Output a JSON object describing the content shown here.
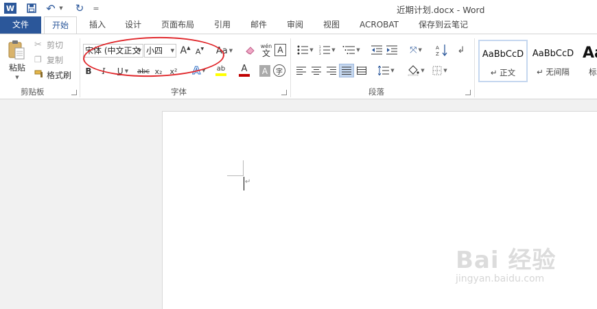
{
  "titlebar": {
    "title": "近期计划.docx - Word",
    "word_icon": "W",
    "save_icon": "floppy-icon",
    "undo_icon": "↶",
    "redo_icon": "↻",
    "customize_icon": "="
  },
  "tabs": {
    "file": "文件",
    "home": "开始",
    "insert": "插入",
    "design": "设计",
    "layout": "页面布局",
    "references": "引用",
    "mailings": "邮件",
    "review": "审阅",
    "view": "视图",
    "acrobat": "ACROBAT",
    "youdao": "保存到云笔记"
  },
  "clipboard": {
    "paste": "粘贴",
    "cut": "剪切",
    "copy": "复制",
    "format_painter": "格式刷",
    "group_label": "剪贴板"
  },
  "font": {
    "font_name": "宋体 (中文正文",
    "font_size": "小四",
    "grow": "A",
    "shrink": "A",
    "change_case": "Aa",
    "clear_format": "",
    "phonetic": "wén",
    "phonetic_char": "文",
    "border_char": "A",
    "bold": "B",
    "italic": "I",
    "underline": "U",
    "strike": "abc",
    "subscript": "x₂",
    "superscript": "x²",
    "text_effect": "A",
    "highlight": "ab",
    "font_color": "A",
    "char_shading": "A",
    "enclose_char": "字",
    "group_label": "字体"
  },
  "paragraph": {
    "group_label": "段落"
  },
  "styles": {
    "normal_sample": "AaBbCcD",
    "normal_name": "正文",
    "nospacing_sample": "AaBbCcD",
    "nospacing_name": "无间隔",
    "heading_sample": "Aa",
    "heading_name": "标"
  },
  "watermark": {
    "brand": "Bai 经验",
    "url": "jingyan.baidu.com"
  },
  "colors": {
    "brand_blue": "#2b579a",
    "highlight_ellipse": "#e0262a",
    "font_color_bar": "#c00000",
    "highlight_bar": "#ffff00"
  }
}
